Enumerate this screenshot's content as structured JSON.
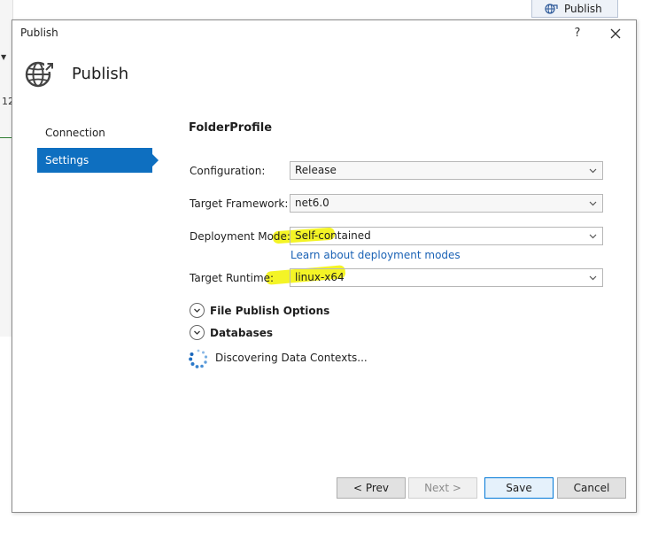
{
  "background": {
    "left_number": "12",
    "tab_label": "Publish"
  },
  "dialog": {
    "title": "Publish",
    "help_label": "?",
    "header_title": "Publish",
    "nav": {
      "connection": "Connection",
      "settings": "Settings"
    },
    "profile_name": "FolderProfile",
    "fields": {
      "configuration": {
        "label": "Configuration:",
        "value": "Release"
      },
      "framework": {
        "label": "Target Framework:",
        "value": "net6.0"
      },
      "deployment": {
        "label": "Deployment Mode:",
        "value": "Self-contained"
      },
      "runtime": {
        "label": "Target Runtime:",
        "value": "linux-x64"
      }
    },
    "learn_link": "Learn about deployment modes",
    "sections": {
      "file_publish": "File Publish Options",
      "databases": "Databases"
    },
    "status": "Discovering Data Contexts...",
    "buttons": {
      "prev": "< Prev",
      "next": "Next >",
      "save": "Save",
      "cancel": "Cancel"
    }
  },
  "colors": {
    "accent": "#0e6fc0",
    "link": "#1a62b5",
    "highlight": "#f2f200"
  }
}
